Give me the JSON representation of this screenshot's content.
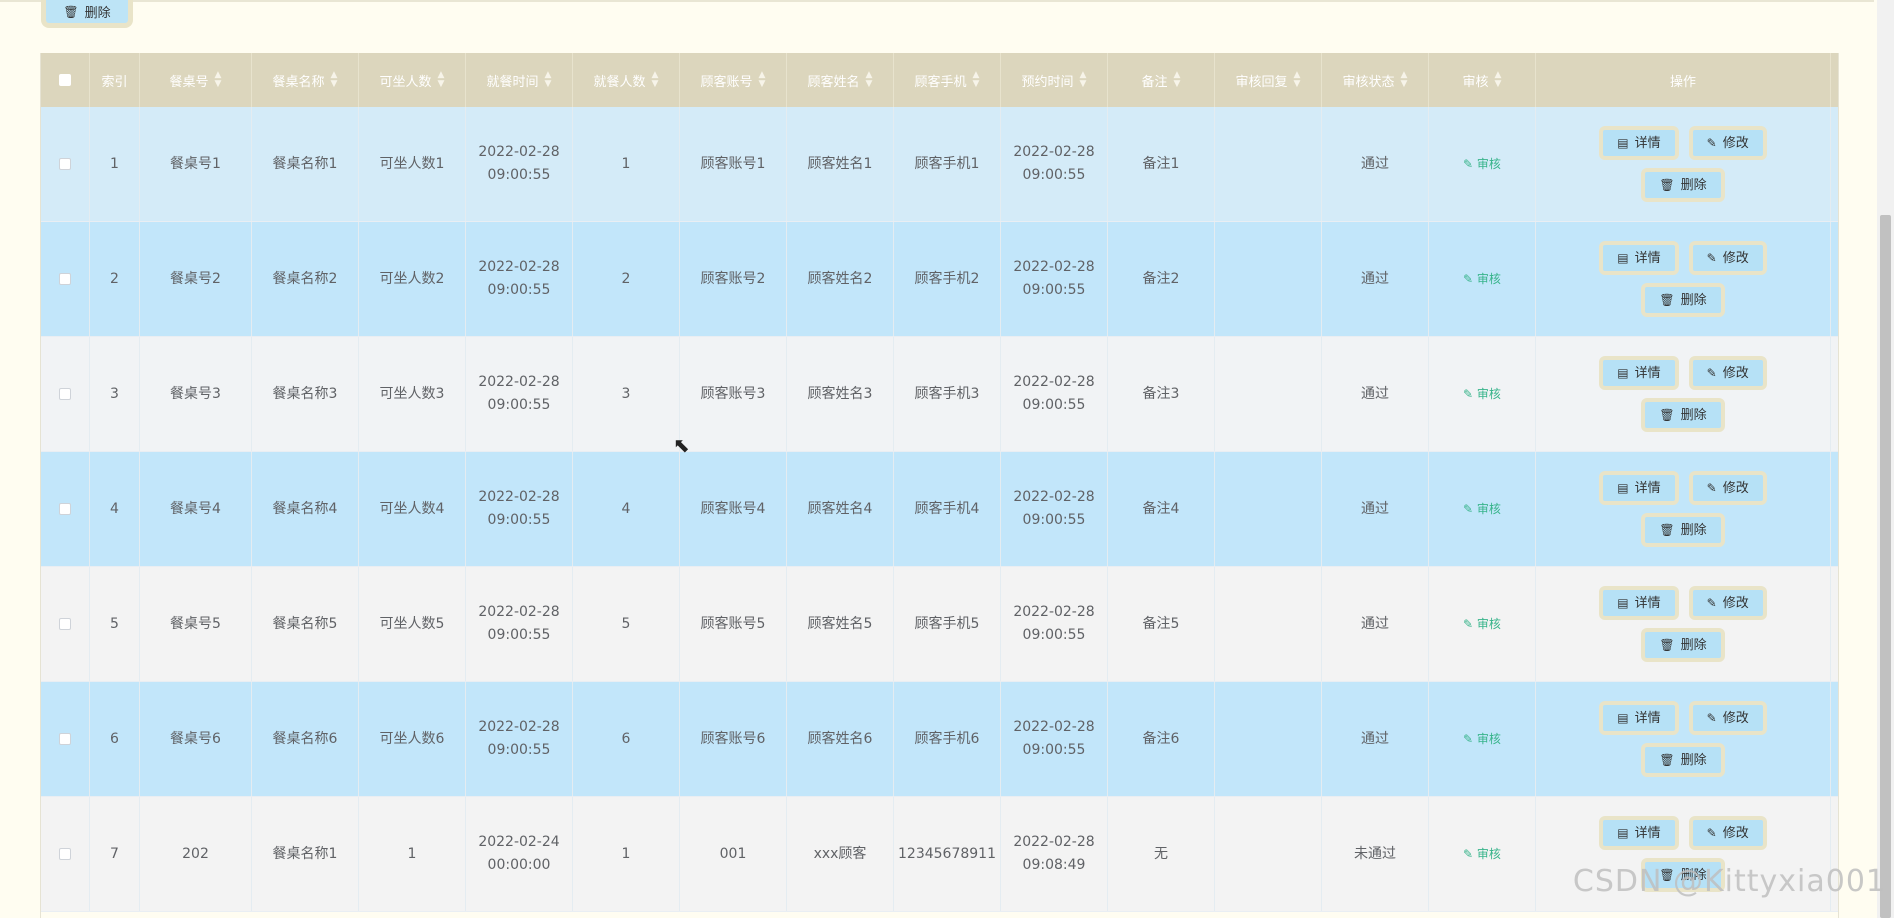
{
  "toolbar": {
    "delete_label": "删除"
  },
  "table": {
    "columns": [
      "索引",
      "餐桌号",
      "餐桌名称",
      "可坐人数",
      "就餐时间",
      "就餐人数",
      "顾客账号",
      "顾客姓名",
      "顾客手机",
      "预约时间",
      "备注",
      "审核回复",
      "审核状态",
      "审核",
      "操作"
    ],
    "review_link": "审核",
    "ops": {
      "detail": "详情",
      "edit": "修改",
      "delete": "删除"
    },
    "rows": [
      {
        "index": "1",
        "table_no": "餐桌号1",
        "table_name": "餐桌名称1",
        "seats": "可坐人数1",
        "dine_time": "2022-02-28 09:00:55",
        "dine_count": "1",
        "account": "顾客账号1",
        "name": "顾客姓名1",
        "phone": "顾客手机1",
        "reserve_time": "2022-02-28 09:00:55",
        "remark": "备注1",
        "reply": "",
        "status": "通过"
      },
      {
        "index": "2",
        "table_no": "餐桌号2",
        "table_name": "餐桌名称2",
        "seats": "可坐人数2",
        "dine_time": "2022-02-28 09:00:55",
        "dine_count": "2",
        "account": "顾客账号2",
        "name": "顾客姓名2",
        "phone": "顾客手机2",
        "reserve_time": "2022-02-28 09:00:55",
        "remark": "备注2",
        "reply": "",
        "status": "通过"
      },
      {
        "index": "3",
        "table_no": "餐桌号3",
        "table_name": "餐桌名称3",
        "seats": "可坐人数3",
        "dine_time": "2022-02-28 09:00:55",
        "dine_count": "3",
        "account": "顾客账号3",
        "name": "顾客姓名3",
        "phone": "顾客手机3",
        "reserve_time": "2022-02-28 09:00:55",
        "remark": "备注3",
        "reply": "",
        "status": "通过"
      },
      {
        "index": "4",
        "table_no": "餐桌号4",
        "table_name": "餐桌名称4",
        "seats": "可坐人数4",
        "dine_time": "2022-02-28 09:00:55",
        "dine_count": "4",
        "account": "顾客账号4",
        "name": "顾客姓名4",
        "phone": "顾客手机4",
        "reserve_time": "2022-02-28 09:00:55",
        "remark": "备注4",
        "reply": "",
        "status": "通过"
      },
      {
        "index": "5",
        "table_no": "餐桌号5",
        "table_name": "餐桌名称5",
        "seats": "可坐人数5",
        "dine_time": "2022-02-28 09:00:55",
        "dine_count": "5",
        "account": "顾客账号5",
        "name": "顾客姓名5",
        "phone": "顾客手机5",
        "reserve_time": "2022-02-28 09:00:55",
        "remark": "备注5",
        "reply": "",
        "status": "通过"
      },
      {
        "index": "6",
        "table_no": "餐桌号6",
        "table_name": "餐桌名称6",
        "seats": "可坐人数6",
        "dine_time": "2022-02-28 09:00:55",
        "dine_count": "6",
        "account": "顾客账号6",
        "name": "顾客姓名6",
        "phone": "顾客手机6",
        "reserve_time": "2022-02-28 09:00:55",
        "remark": "备注6",
        "reply": "",
        "status": "通过"
      },
      {
        "index": "7",
        "table_no": "202",
        "table_name": "餐桌名称1",
        "seats": "1",
        "dine_time": "2022-02-24 00:00:00",
        "dine_count": "1",
        "account": "001",
        "name": "xxx顾客",
        "phone": "12345678911",
        "reserve_time": "2022-02-28 09:08:49",
        "remark": "无",
        "reply": "",
        "status": "未通过"
      }
    ]
  },
  "watermark": "CSDN @Kittyxia001"
}
